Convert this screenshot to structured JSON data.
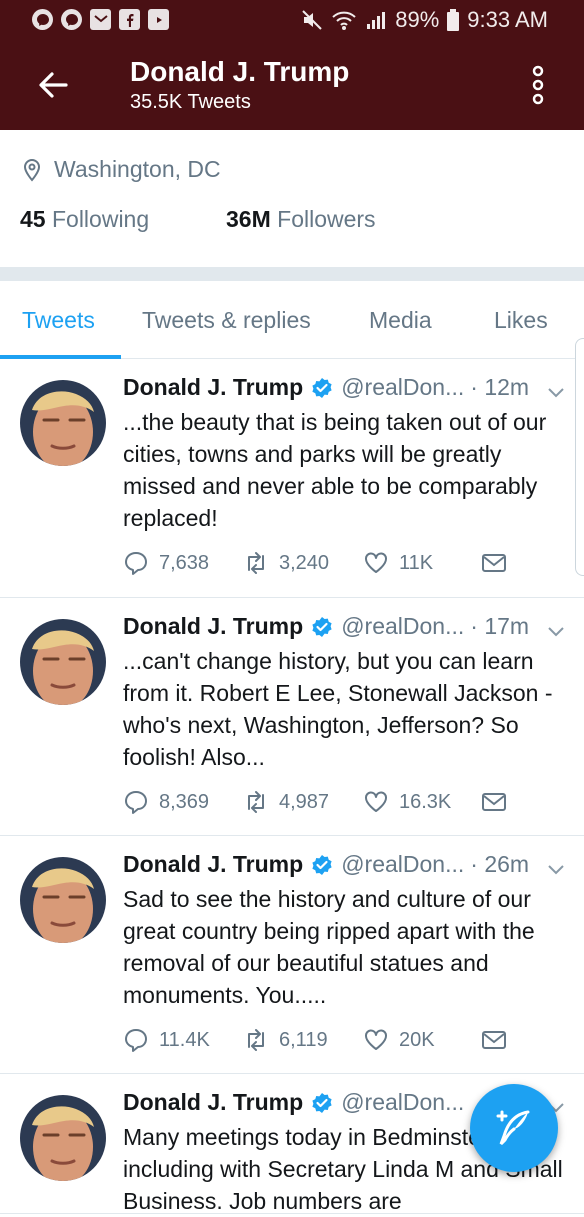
{
  "status_bar": {
    "battery": "89%",
    "time": "9:33 AM"
  },
  "header": {
    "title": "Donald J. Trump",
    "subtitle": "35.5K Tweets"
  },
  "profile": {
    "location": "Washington, DC",
    "following_count": "45",
    "following_label": "Following",
    "followers_count": "36M",
    "followers_label": "Followers"
  },
  "tabs": [
    "Tweets",
    "Tweets & replies",
    "Media",
    "Likes"
  ],
  "active_tab": "Tweets",
  "tweets": [
    {
      "name": "Donald J. Trump",
      "handle": "@realDon...",
      "time": "· 12m",
      "text": "...the beauty that is being taken out of our cities, towns and parks will be greatly missed and never able to be comparably replaced!",
      "replies": "7,638",
      "retweets": "3,240",
      "likes": "11K"
    },
    {
      "name": "Donald J. Trump",
      "handle": "@realDon...",
      "time": "· 17m",
      "text": "...can't change history, but you can learn from it. Robert E Lee, Stonewall Jackson - who's next, Washington, Jefferson? So foolish! Also...",
      "replies": "8,369",
      "retweets": "4,987",
      "likes": "16.3K"
    },
    {
      "name": "Donald J. Trump",
      "handle": "@realDon...",
      "time": "· 26m",
      "text": "Sad to see the history and culture of our great country being ripped apart with the removal of our beautiful statues and monuments. You.....",
      "replies": "11.4K",
      "retweets": "6,119",
      "likes": "20K"
    },
    {
      "name": "Donald J. Trump",
      "handle": "@realDon...",
      "time": "",
      "text": "Many meetings today in Bedminster, including with Secretary Linda M and Small Business. Job numbers are",
      "replies": "",
      "retweets": "",
      "likes": ""
    }
  ],
  "icons": {
    "back": "arrow-left-icon",
    "more": "vertical-dots-icon",
    "location": "location-pin-icon",
    "verified": "verified-badge-icon",
    "reply": "reply-icon",
    "retweet": "retweet-icon",
    "like": "heart-icon",
    "dm": "envelope-icon",
    "compose": "compose-feather-icon"
  },
  "colors": {
    "header_bg": "#4a1014",
    "accent": "#1da1f2",
    "secondary_text": "#657786"
  }
}
